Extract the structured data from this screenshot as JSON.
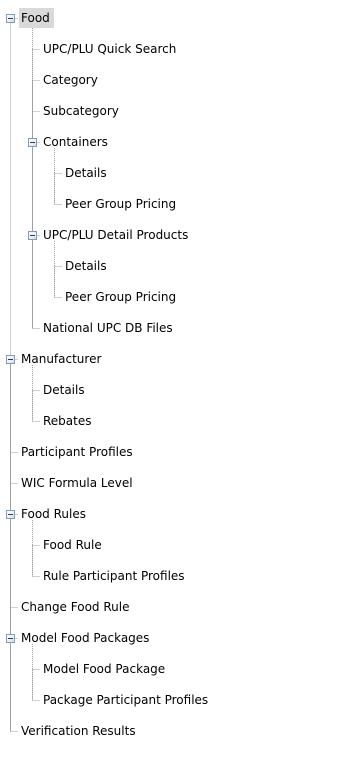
{
  "tree": {
    "items": [
      {
        "label": "Food",
        "level": 0,
        "expanded": true,
        "selected": true
      },
      {
        "label": "UPC/PLU Quick Search",
        "level": 1
      },
      {
        "label": "Category",
        "level": 1
      },
      {
        "label": "Subcategory",
        "level": 1
      },
      {
        "label": "Containers",
        "level": 1,
        "expanded": true
      },
      {
        "label": "Details",
        "level": 2
      },
      {
        "label": "Peer Group Pricing",
        "level": 2
      },
      {
        "label": "UPC/PLU Detail Products",
        "level": 1,
        "expanded": true
      },
      {
        "label": "Details",
        "level": 2
      },
      {
        "label": "Peer Group Pricing",
        "level": 2
      },
      {
        "label": "National UPC DB Files",
        "level": 1
      },
      {
        "label": "Manufacturer",
        "level": 0,
        "expanded": true
      },
      {
        "label": "Details",
        "level": 1
      },
      {
        "label": "Rebates",
        "level": 1
      },
      {
        "label": "Participant Profiles",
        "level": 0
      },
      {
        "label": "WIC Formula Level",
        "level": 0
      },
      {
        "label": "Food Rules",
        "level": 0,
        "expanded": true
      },
      {
        "label": "Food Rule",
        "level": 1
      },
      {
        "label": "Rule Participant Profiles",
        "level": 1
      },
      {
        "label": "Change Food Rule",
        "level": 0
      },
      {
        "label": "Model Food Packages",
        "level": 0,
        "expanded": true
      },
      {
        "label": "Model Food Package",
        "level": 1
      },
      {
        "label": "Package Participant Profiles",
        "level": 1
      },
      {
        "label": "Verification Results",
        "level": 0
      }
    ]
  }
}
